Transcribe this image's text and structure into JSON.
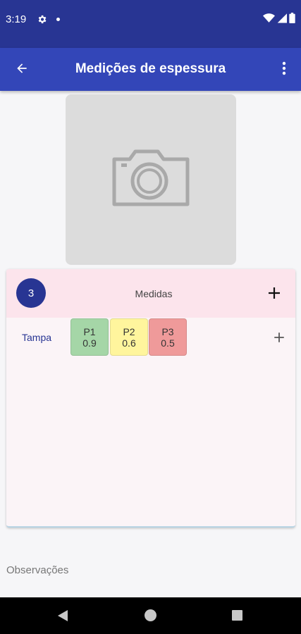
{
  "status_bar": {
    "time": "3:19",
    "icons": [
      "gear-icon",
      "notification-dot-icon",
      "wifi-icon",
      "signal-icon",
      "battery-icon"
    ]
  },
  "app_bar": {
    "title": "Medições de espessura",
    "back_icon": "arrow-left-icon",
    "menu_icon": "more-vert-icon"
  },
  "photo": {
    "icon": "camera-icon"
  },
  "card": {
    "count": "3",
    "title": "Medidas",
    "add_icon": "plus-icon",
    "rows": [
      {
        "label": "Tampa",
        "measurements": [
          {
            "name": "P1",
            "value": "0.9",
            "color": "#a5d6a7"
          },
          {
            "name": "P2",
            "value": "0.6",
            "color": "#fff59d"
          },
          {
            "name": "P3",
            "value": "0.5",
            "color": "#ef9a9a"
          }
        ]
      }
    ]
  },
  "notes": {
    "label": "Observações"
  },
  "colors": {
    "status_bar": "#283593",
    "app_bar": "#3346b8",
    "card_header": "#fce4ec",
    "card_body": "#fbf4f7",
    "badge": "#283593"
  },
  "nav_bar": {
    "icons": [
      "nav-back-icon",
      "nav-home-icon",
      "nav-recents-icon"
    ]
  }
}
